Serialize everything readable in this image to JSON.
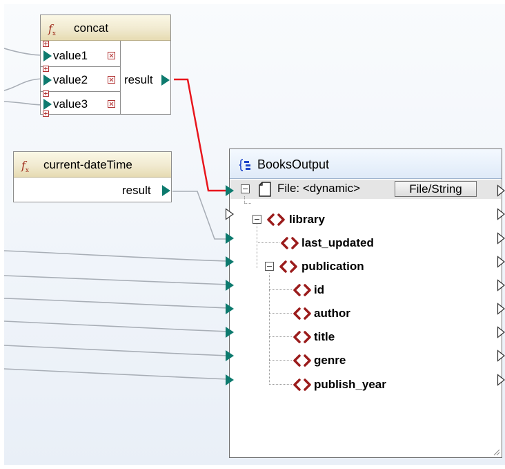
{
  "concat": {
    "title": "concat",
    "inputs": [
      "value1",
      "value2",
      "value3"
    ],
    "output": "result"
  },
  "datetime": {
    "title": "current-dateTime",
    "output": "result"
  },
  "books_output": {
    "title": "BooksOutput",
    "file_label": "File: <dynamic>",
    "file_button": "File/String",
    "nodes": [
      {
        "label": "library",
        "level": 0,
        "expanded": true
      },
      {
        "label": "last_updated",
        "level": 1
      },
      {
        "label": "publication",
        "level": 1,
        "expanded": true
      },
      {
        "label": "id",
        "level": 2
      },
      {
        "label": "author",
        "level": 2
      },
      {
        "label": "title",
        "level": 2
      },
      {
        "label": "genre",
        "level": 2
      },
      {
        "label": "publish_year",
        "level": 2
      }
    ]
  },
  "colors": {
    "active_connection": "#e8161d",
    "connection": "#a8aeb6",
    "input_arrow": "#0d7a6e",
    "element_icon": "#9b1c1c",
    "function_header": "#efe7c8",
    "output_header": "#dfeaf8"
  },
  "icons": {
    "function": "fx-function-icon",
    "component": "xml-component-icon",
    "file": "file-icon",
    "element": "xml-element-icon"
  }
}
